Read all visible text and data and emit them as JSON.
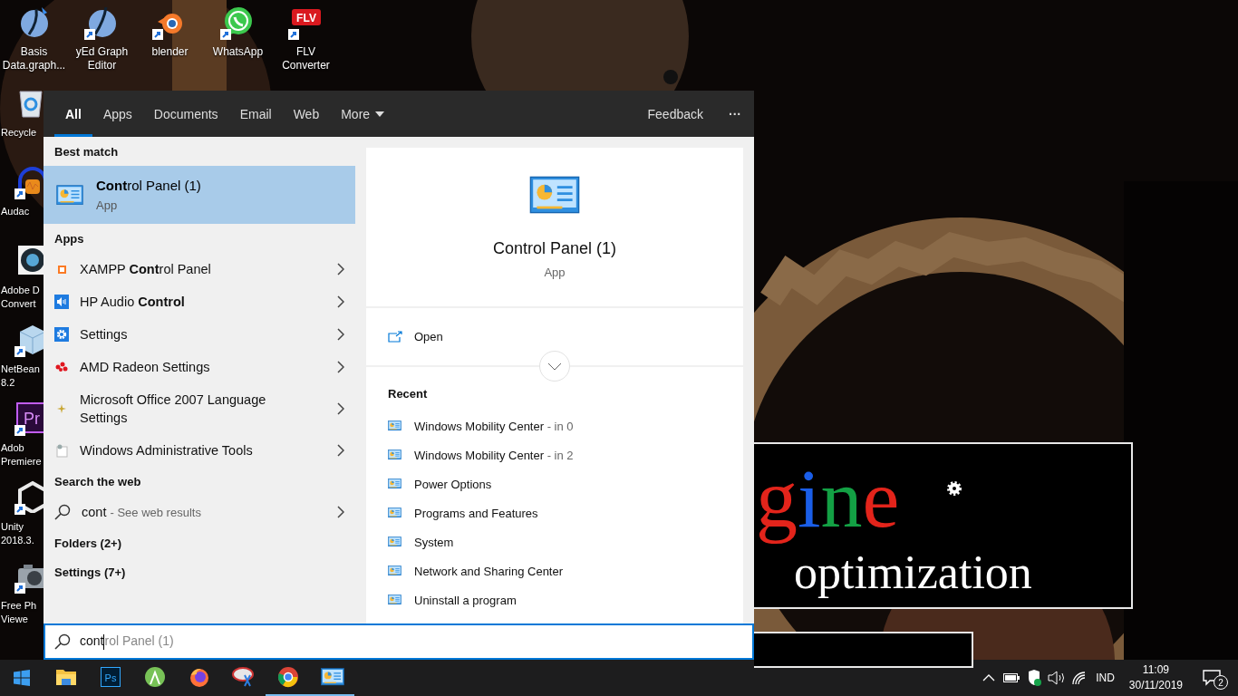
{
  "desktop": {
    "top_icons": [
      {
        "label": "Basis Data.graph...",
        "kind": "sphere",
        "shortcut": false
      },
      {
        "label": "yEd Graph Editor",
        "kind": "yed",
        "shortcut": true
      },
      {
        "label": "blender",
        "kind": "blender",
        "shortcut": true
      },
      {
        "label": "WhatsApp",
        "kind": "whatsapp",
        "shortcut": true
      },
      {
        "label": "FLV Converter",
        "kind": "flv",
        "glyph": "FLV",
        "shortcut": true
      }
    ],
    "side_icons": [
      {
        "lines": [
          "Recycle"
        ],
        "kind": "recycle",
        "shortcut": false
      },
      {
        "lines": [
          "Audac"
        ],
        "kind": "headphones",
        "shortcut": true
      },
      {
        "lines": [
          "Adobe D",
          "Convert"
        ],
        "kind": "lens",
        "shortcut": false
      },
      {
        "lines": [
          "NetBean",
          "8.2"
        ],
        "kind": "cube",
        "shortcut": true
      },
      {
        "lines": [
          "Adob",
          "Premiere"
        ],
        "kind": "premiere",
        "glyph": "Pr",
        "shortcut": true
      },
      {
        "lines": [
          "Unity",
          "2018.3."
        ],
        "kind": "unity",
        "shortcut": true
      },
      {
        "lines": [
          "Free Ph",
          "Viewe"
        ],
        "kind": "camera",
        "shortcut": true
      }
    ],
    "banner": {
      "letters": [
        {
          "text": "g",
          "color": "#e3241b"
        },
        {
          "text": "i",
          "color": "#1a5ee8"
        },
        {
          "text": "n",
          "color": "#13a044"
        },
        {
          "text": "e",
          "color": "#e3241b"
        }
      ],
      "text": "optimization"
    }
  },
  "search": {
    "tabs": [
      {
        "label": "All",
        "selected": true,
        "dropdown": false
      },
      {
        "label": "Apps",
        "selected": false,
        "dropdown": false
      },
      {
        "label": "Documents",
        "selected": false,
        "dropdown": false
      },
      {
        "label": "Email",
        "selected": false,
        "dropdown": false
      },
      {
        "label": "Web",
        "selected": false,
        "dropdown": false
      },
      {
        "label": "More",
        "selected": false,
        "dropdown": true
      }
    ],
    "feedback": "Feedback",
    "more_options": "···",
    "best_match": {
      "heading": "Best match",
      "title": "**Cont**rol Panel (1)",
      "subtitle": "App",
      "selected": true
    },
    "apps": {
      "heading": "Apps",
      "items": [
        {
          "title": "XAMPP **Cont**rol Panel",
          "kind": "xampp"
        },
        {
          "title": "HP Audio **Control**",
          "kind": "audio"
        },
        {
          "title": "Settings",
          "kind": "settings"
        },
        {
          "title": "AMD Radeon Settings",
          "kind": "amd"
        },
        {
          "title": "Microsoft Office 2007 Language Settings",
          "kind": "office"
        },
        {
          "title": "Windows Administrative Tools",
          "kind": "admin"
        }
      ]
    },
    "web": {
      "heading": "Search the web",
      "query": "cont",
      "hint": "- See web results"
    },
    "folders": "Folders (2+)",
    "settings": "Settings (7+)",
    "preview": {
      "title": "Control Panel (1)",
      "subtitle": "App",
      "open": "Open",
      "recent_heading": "Recent",
      "recent": [
        {
          "name": "Windows Mobility Center",
          "detail": "- in 0"
        },
        {
          "name": "Windows Mobility Center",
          "detail": "- in 2"
        },
        {
          "name": "Power Options"
        },
        {
          "name": "Programs and Features"
        },
        {
          "name": "System"
        },
        {
          "name": "Network and Sharing Center"
        },
        {
          "name": "Uninstall a program"
        }
      ]
    },
    "box": {
      "value": "cont",
      "suggestion": "rol Panel (1)"
    }
  },
  "taskbar": {
    "apps": [
      {
        "kind": "folder",
        "running": false
      },
      {
        "kind": "ps",
        "glyph": "Ps",
        "running": false
      },
      {
        "kind": "android",
        "running": false
      },
      {
        "kind": "firefox",
        "running": false
      },
      {
        "kind": "snip",
        "running": false
      },
      {
        "kind": "chrome",
        "running": true
      },
      {
        "kind": "control",
        "running": true
      }
    ],
    "language": "IND",
    "time": "11:09",
    "date": "30/11/2019",
    "notifications": "2"
  }
}
